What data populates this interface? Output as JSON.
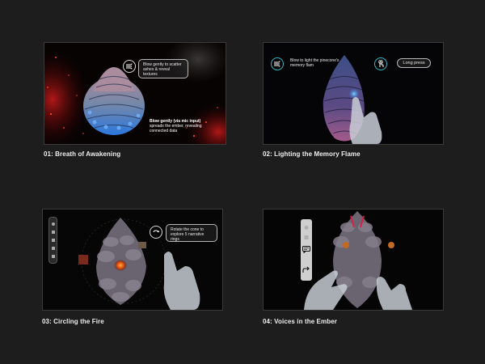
{
  "panels": [
    {
      "caption": "01: Breath of Awakening",
      "tooltip": "Blow gently to scatter ashes & reveal textures",
      "note_bold": "Blow gently (via mic input)",
      "note_text": "spreads the ember, revealing connected data",
      "icons": [
        "wind-icon"
      ]
    },
    {
      "caption": "02: Lighting the Memory Flame",
      "tooltip": "Blow to light the pinecone's memory flam",
      "action": "Long press",
      "icons": [
        "wind-icon",
        "hand-press-icon"
      ]
    },
    {
      "caption": "03: Circling the Fire",
      "tooltip": "Rotate the cone to explore 5 narrative rings",
      "icons": [
        "rotate-icon"
      ]
    },
    {
      "caption": "04: Voices in the Ember",
      "icons": [
        "chat-icon",
        "share-icon"
      ]
    }
  ],
  "colors": {
    "accent": "#33b9c8",
    "ember": "#d32020",
    "background": "#1e1d1d"
  }
}
